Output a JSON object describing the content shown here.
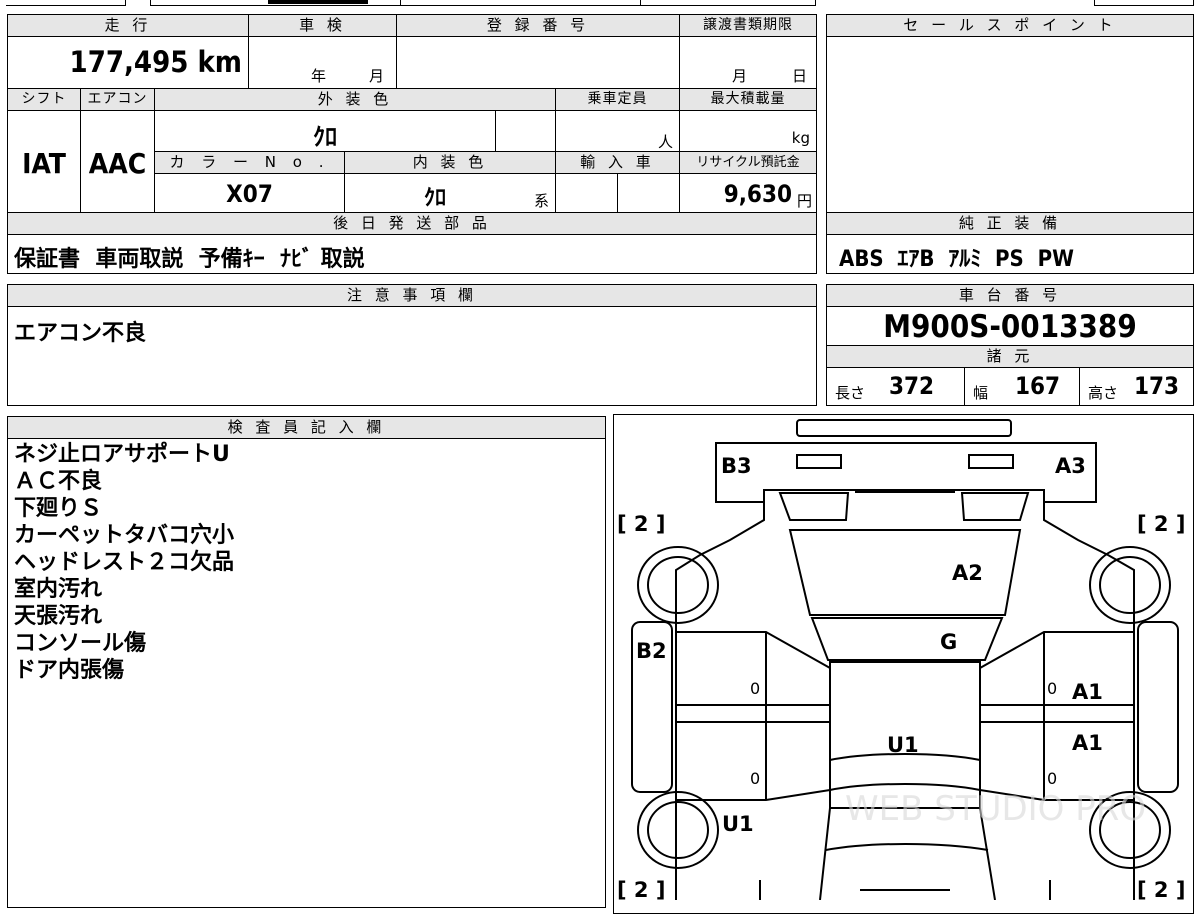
{
  "headers": {
    "mileage": "走 行",
    "inspection": "車 検",
    "registration_no": "登 録 番 号",
    "transfer_deadline": "譲渡書類期限",
    "sale_points": "セ ー ル ス ポ イ ン ト",
    "shift": "シフト",
    "aircon": "エアコン",
    "exterior_color": "外 装 色",
    "capacity": "乗車定員",
    "max_load": "最大積載量",
    "color_no": "カ ラ ー N o .",
    "interior_color": "内 装 色",
    "import": "輸 入 車",
    "recycle_fee": "リサイクル預託金",
    "later_shipment": "後 日 発 送 部 品",
    "genuine_equipment": "純 正 装 備",
    "notes": "注 意 事 項 欄",
    "chassis_no": "車 台 番 号",
    "specs": "諸 元",
    "inspector_notes": "検 査 員 記 入 欄"
  },
  "values": {
    "mileage": "177,495 km",
    "inspection_year_unit": "年",
    "inspection_month_unit": "月",
    "transfer_month_unit": "月",
    "transfer_day_unit": "日",
    "shift": "IAT",
    "aircon": "AAC",
    "exterior_color": "ｸﾛ",
    "capacity_unit": "人",
    "max_load_unit": "kg",
    "color_no": "X07",
    "interior_color": "ｸﾛ",
    "interior_suffix": "系",
    "recycle_fee": "9,630",
    "recycle_fee_unit": "円",
    "later_shipment": "保証書  車両取説  予備ｷｰ  ﾅﾋﾞ 取説",
    "genuine_equipment": "ABS  ｴｱB  ｱﾙﾐ  PS  PW",
    "notes": "エアコン不良",
    "chassis_no": "M900S-0013389",
    "length_label": "長さ",
    "length": "372",
    "width_label": "幅",
    "width": "167",
    "height_label": "高さ",
    "height": "173"
  },
  "inspector_remarks": [
    "ネジ止ロアサポートU",
    "ＡＣ不良",
    "下廻りＳ",
    "カーペットタバコ穴小",
    "ヘッドレスト２コ欠品",
    "室内汚れ",
    "天張汚れ",
    "コンソール傷",
    "ドア内張傷"
  ],
  "diagram": {
    "tire_tl": "[ 2 ]",
    "tire_tr": "[ 2 ]",
    "tire_bl": "[ 2 ]",
    "tire_br": "[ 2 ]",
    "b3": "B3",
    "a3": "A3",
    "a2": "A2",
    "g": "G",
    "b2": "B2",
    "a1_top": "A1",
    "a1_bottom": "A1",
    "u1_center": "U1",
    "u1_left": "U1",
    "zero_ld_top": "0",
    "zero_ld_bottom": "0",
    "zero_rd_top": "0",
    "zero_rd_bottom": "0",
    "watermark": "WEB STUDIO PRO"
  }
}
